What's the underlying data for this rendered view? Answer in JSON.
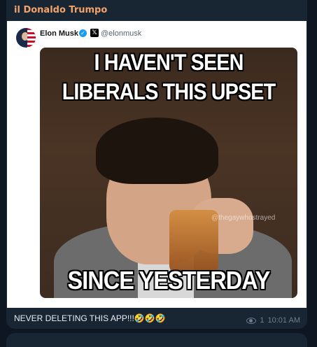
{
  "message": {
    "sender": "il Donaldo Trumpo",
    "caption": "NEVER DELETING THIS APP!!!🤣🤣🤣",
    "views": "1",
    "time": "10:01 AM"
  },
  "post": {
    "author": "Elon Musk",
    "handle": "@elonmusk",
    "verified_icon": "verified-badge-icon",
    "platform_icon": "x-logo-icon"
  },
  "meme": {
    "top_line_1": "I HAVEN'T SEEN",
    "top_line_2": "LIBERALS THIS UPSET",
    "bottom_line": "SINCE YESTERDAY",
    "watermark": "@thegaywhostrayed"
  },
  "colors": {
    "background": "#0e1621",
    "bubble": "#182533",
    "sender": "#f2a36a",
    "meta": "#6d7f8f"
  }
}
